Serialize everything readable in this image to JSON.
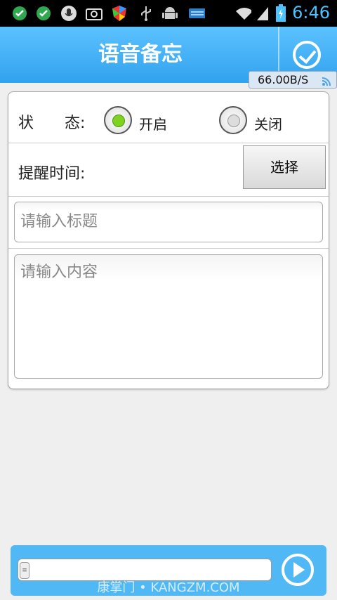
{
  "status_bar": {
    "time": "6:46",
    "icons": [
      "check-circle-icon",
      "check-circle-icon",
      "microphone-icon",
      "camera-icon",
      "shield-icon",
      "usb-icon",
      "android-icon",
      "keyboard-icon",
      "wifi-icon",
      "signal-icon",
      "battery-icon"
    ]
  },
  "header": {
    "title": "语音备忘",
    "confirm_icon": "check-circle-icon",
    "network_speed": "66.00B/S"
  },
  "form": {
    "status_label": "状　　态:",
    "status_on_label": "开启",
    "status_off_label": "关闭",
    "selected_status": "开启",
    "reminder_label": "提醒时间:",
    "select_button": "选择",
    "title_placeholder": "请输入标题",
    "content_placeholder": "请输入内容"
  },
  "bottom": {
    "voice_input_value": "",
    "play_icon": "play-icon",
    "watermark": "康掌门 • KANGZM.COM"
  },
  "colors": {
    "accent": "#3aa8f0",
    "radio_on": "#7fd21f"
  }
}
